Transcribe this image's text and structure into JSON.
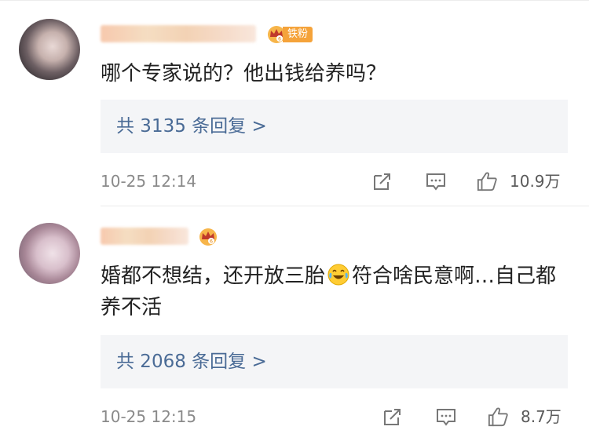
{
  "comments": [
    {
      "text": "哪个专家说的？他出钱给养吗？",
      "fan_badge": "铁粉",
      "reply_link": "共 3135 条回复 >",
      "time": "10-25 12:14",
      "likes": "10.9万",
      "icons": {
        "badge": "crown-fan-icon",
        "share": "share-icon",
        "reply": "comment-icon",
        "like": "thumbs-up-icon"
      }
    },
    {
      "text_before_emoji": "婚都不想结，还开放三胎",
      "emoji": "laugh-cry-emoji",
      "text_after_emoji": "符合啥民意啊…自己都养不活",
      "reply_link": "共 2068 条回复 >",
      "time": "10-25 12:15",
      "likes": "8.7万",
      "icons": {
        "badge": "crown-fan-icon",
        "share": "share-icon",
        "reply": "comment-icon",
        "like": "thumbs-up-icon"
      }
    }
  ],
  "colors": {
    "link": "#4a6b96",
    "badge_orange": "#f5a33a",
    "reply_bg": "#f4f5f7",
    "meta_gray": "#8a8a8a"
  }
}
